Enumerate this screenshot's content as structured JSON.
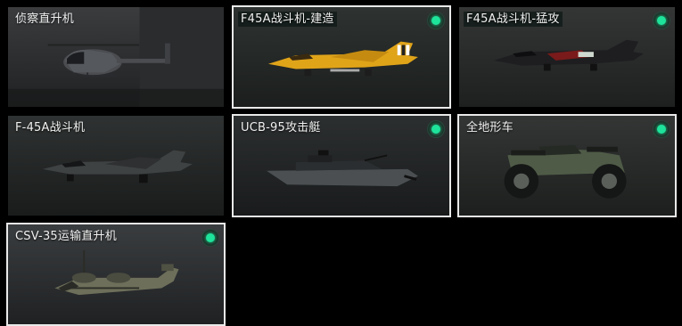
{
  "vehicles": [
    {
      "title": "侦察直升机",
      "icon": "helicopter-icon",
      "selected": false,
      "equipped": false
    },
    {
      "title": "F45A战斗机-建造",
      "icon": "fighter-jet-yellow-icon",
      "selected": true,
      "equipped": true
    },
    {
      "title": "F45A战斗机-猛攻",
      "icon": "fighter-jet-dark-icon",
      "selected": false,
      "equipped": true
    },
    {
      "title": "F-45A战斗机",
      "icon": "fighter-jet-icon",
      "selected": false,
      "equipped": false
    },
    {
      "title": "UCB-95攻击艇",
      "icon": "attack-boat-icon",
      "selected": true,
      "equipped": true
    },
    {
      "title": "全地形车",
      "icon": "atv-icon",
      "selected": true,
      "equipped": true
    },
    {
      "title": "CSV-35运输直升机",
      "icon": "tiltrotor-icon",
      "selected": true,
      "equipped": true
    }
  ],
  "colors": {
    "equipped_dot": "#1ee39a",
    "selected_border": "#e9e9e9",
    "background": "#000000"
  }
}
